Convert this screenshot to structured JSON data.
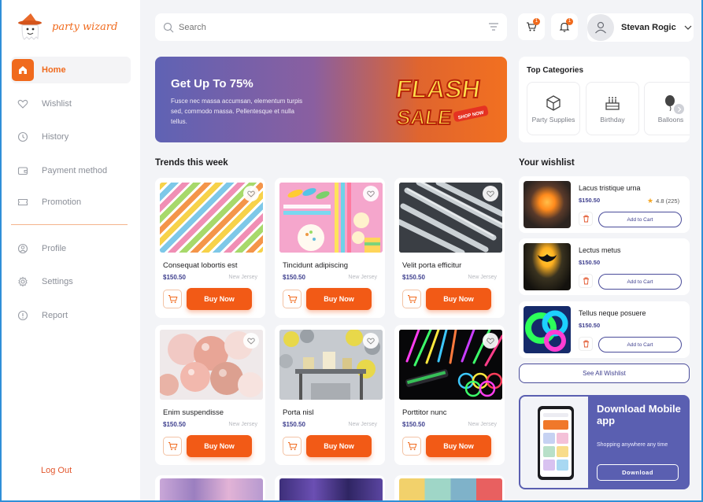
{
  "brand": {
    "name": "party wizard",
    "accent": "#f06a1d"
  },
  "sidebar": {
    "items": [
      {
        "label": "Home",
        "icon": "home-icon",
        "active": true
      },
      {
        "label": "Wishlist",
        "icon": "heart-icon"
      },
      {
        "label": "History",
        "icon": "clock-icon"
      },
      {
        "label": "Payment method",
        "icon": "wallet-icon"
      },
      {
        "label": "Promotion",
        "icon": "ticket-icon"
      }
    ],
    "items2": [
      {
        "label": "Profile",
        "icon": "user-icon"
      },
      {
        "label": "Settings",
        "icon": "gear-icon"
      },
      {
        "label": "Report",
        "icon": "info-icon"
      }
    ],
    "logout": "Log Out"
  },
  "header": {
    "search_placeholder": "Search",
    "cart_badge": "1",
    "notif_badge": "1",
    "user_name": "Stevan Rogic"
  },
  "banner": {
    "title": "Get Up To 75%",
    "text": "Fusce nec massa accumsan, elementum turpis sed, commodo massa. Pellentesque et nulla tellus.",
    "flash_word1": "FLASH",
    "flash_word2": "SALE",
    "shop_now": "SHOP NOW"
  },
  "categories": {
    "title": "Top Categories",
    "items": [
      {
        "label": "Party Supplies",
        "icon": "box-icon"
      },
      {
        "label": "Birthday",
        "icon": "cake-icon"
      },
      {
        "label": "Balloons",
        "icon": "balloon-icon"
      }
    ]
  },
  "trends": {
    "title": "Trends this week",
    "buy_label": "Buy Now",
    "products": [
      {
        "name": "Consequat lobortis est",
        "price": "$150.50",
        "location": "New Jersey"
      },
      {
        "name": "Tincidunt adipiscing",
        "price": "$150.50",
        "location": "New Jersey"
      },
      {
        "name": "Velit porta efficitur",
        "price": "$150.50",
        "location": "New Jersey"
      },
      {
        "name": "Enim suspendisse",
        "price": "$150.50",
        "location": "New Jersey"
      },
      {
        "name": "Porta nisl",
        "price": "$150.50",
        "location": "New Jersey"
      },
      {
        "name": "Porttitor nunc",
        "price": "$150.50",
        "location": "New Jersey"
      }
    ]
  },
  "wishlist": {
    "title": "Your wishlist",
    "add_label": "Add to Cart",
    "see_all": "See All Wishlist",
    "items": [
      {
        "name": "Lacus tristique urna",
        "price": "$150.50",
        "rating": "4.8 (225)"
      },
      {
        "name": "Lectus metus",
        "price": "$150.50"
      },
      {
        "name": "Tellus neque posuere",
        "price": "$150.50"
      }
    ]
  },
  "promo": {
    "title": "Download Mobile app",
    "subtitle": "Shopping anywhere any time",
    "button": "Download"
  }
}
